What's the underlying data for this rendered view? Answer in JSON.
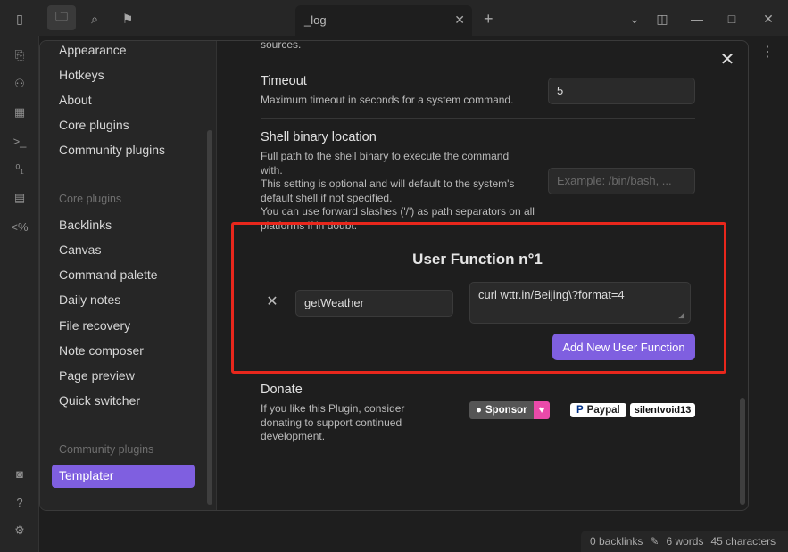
{
  "app": {
    "tab_title": "_log",
    "status": {
      "backlinks": "0 backlinks",
      "words": "6 words",
      "characters": "45 characters"
    }
  },
  "settings_sidebar": {
    "items_top": [
      "Appearance",
      "Hotkeys",
      "About",
      "Core plugins",
      "Community plugins"
    ],
    "core_heading": "Core plugins",
    "core_items": [
      "Backlinks",
      "Canvas",
      "Command palette",
      "Daily notes",
      "File recovery",
      "Note composer",
      "Page preview",
      "Quick switcher"
    ],
    "community_heading": "Community plugins",
    "community_items": [
      "Templater"
    ],
    "active_item": "Templater"
  },
  "content": {
    "top_cut_text": "sources.",
    "timeout": {
      "title": "Timeout",
      "description": "Maximum timeout in seconds for a system command.",
      "value": "5"
    },
    "shell": {
      "title": "Shell binary location",
      "desc_line1": "Full path to the shell binary to execute the command",
      "desc_line2": "with.",
      "desc_line3": "This setting is optional and will default to the system's",
      "desc_line4": "default shell if not specified.",
      "desc_line5": "You can use forward slashes ('/') as path separators on all",
      "desc_line6": "platforms if in doubt.",
      "placeholder": "Example: /bin/bash, ..."
    },
    "user_function": {
      "title": "User Function n°1",
      "name_value": "getWeather",
      "command_value": "curl wttr.in/Beijing\\?format=4",
      "add_button": "Add New User Function"
    },
    "donate": {
      "title": "Donate",
      "desc_line1": "If you like this Plugin, consider",
      "desc_line2": "donating to support continued",
      "desc_line3": "development.",
      "sponsor_label": "Sponsor",
      "paypal_label": "Paypal",
      "paypal_user": "silentvoid13"
    }
  },
  "colors": {
    "accent": "#7f5fe0",
    "highlight_box": "#e8271c",
    "background": "#1e1e1e",
    "sidebar": "#262626"
  }
}
